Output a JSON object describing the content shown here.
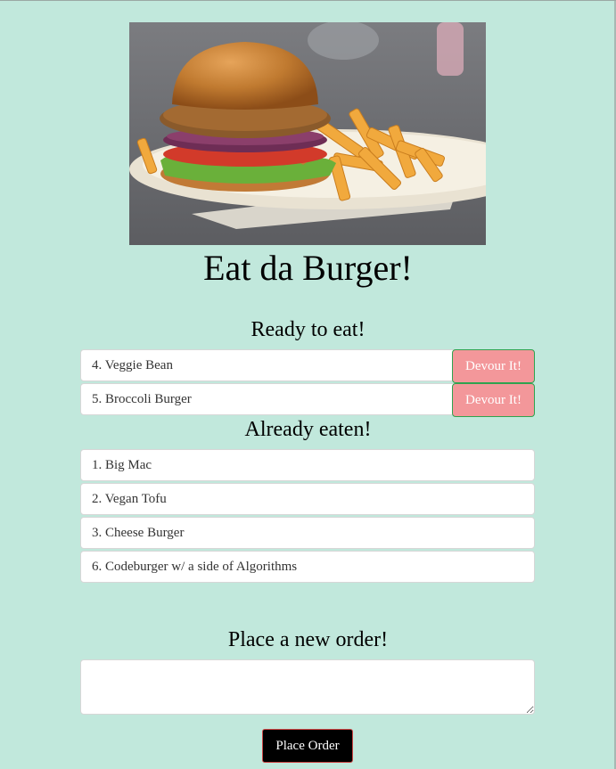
{
  "page": {
    "title": "Eat da Burger!",
    "hero_image": "burger-and-fries-photo"
  },
  "ready": {
    "heading": "Ready to eat!",
    "button_label": "Devour It!",
    "items": [
      {
        "label": "4. Veggie Bean"
      },
      {
        "label": "5. Broccoli Burger"
      }
    ]
  },
  "eaten": {
    "heading": "Already eaten!",
    "items": [
      {
        "label": "1. Big Mac"
      },
      {
        "label": "2. Vegan Tofu"
      },
      {
        "label": "3. Cheese Burger"
      },
      {
        "label": "6. Codeburger w/ a side of Algorithms"
      }
    ]
  },
  "order": {
    "heading": "Place a new order!",
    "input_value": "",
    "button_label": "Place Order"
  },
  "colors": {
    "background": "#c1e8dc",
    "devour_button": "#f3979a",
    "devour_border": "#2fa34f",
    "order_button": "#000000"
  }
}
